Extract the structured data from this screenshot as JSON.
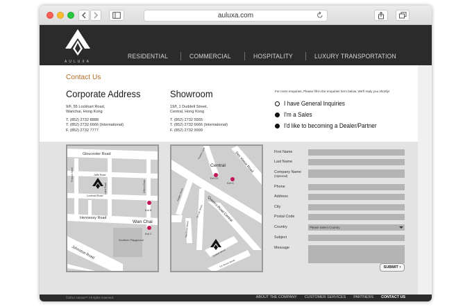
{
  "browser": {
    "url": "auluxa.com",
    "new_tab_symbol": "+"
  },
  "header": {
    "logo_text": "AULUXA",
    "nav": [
      "RESIDENTIAL",
      "COMMERCIAL",
      "HOSPITALITY",
      "LUXURY TRANSPORTATION"
    ]
  },
  "contact": {
    "title": "Contact Us",
    "corporate": {
      "heading": "Corporate Address",
      "line1": "9/F, 55 Lockhart Road,",
      "line2": "Wanchai, Hong Kong",
      "tel": "T. (852) 2732 8888",
      "tel_intl": "T. (852) 2732 6666 (International)",
      "fax": "F. (852) 2732 7777"
    },
    "showroom": {
      "heading": "Showroom",
      "line1": "19/f, 1 Duddell Street,",
      "line2": "Central, Hong Kong",
      "tel": "T. (852) 2732 5555",
      "tel_intl": "T. (852) 2732 6666 (International)",
      "fax": "F. (852) 2732 9999"
    },
    "enquiry_note": "For more enquiries, Please fill-in the enquiries form below. We'll reply you shortly!",
    "options": [
      {
        "label": "I have General Inquiries",
        "selected": false
      },
      {
        "label": "I'm a Sales",
        "selected": true
      },
      {
        "label": "I'd like to becoming a Dealer/Partner",
        "selected": true
      }
    ]
  },
  "maps": {
    "map1": {
      "gloucester": "Gloucester Road",
      "jaffe": "Jaffe Road",
      "lockhart": "Lockhart Road",
      "hennessy": "Hennessy Road",
      "johnston": "Johnston Road",
      "fenwick": "Fenwick Street",
      "luard": "Luard Road",
      "odell": "O'Brien Road",
      "wanchai": "Wan Chai",
      "exit_b": "Exit B",
      "exit_c": "Exit C",
      "playground": "Southern Playground"
    },
    "map2": {
      "central": "Central",
      "desvoeux": "Des Voeux Road",
      "queens": "Queen's Road Central",
      "theatre": "Theatre Lane",
      "pedder": "Pedder Street",
      "wyndham": "Wyndham Street",
      "onlan": "On Lan Street",
      "duddell": "Duddell Street",
      "icehouse": "Ice House Street",
      "exit_d1": "Exit D1",
      "exit_g": "Exit G"
    }
  },
  "form": {
    "first_name": "First Name",
    "last_name": "Last Name",
    "company": "Company Name",
    "company_optional": "(Optional)",
    "phone": "Phone",
    "address": "Address",
    "city": "City",
    "postal": "Postal Code",
    "country": "Country",
    "country_select": "Please Select Country",
    "subject": "Subject",
    "message": "Message",
    "submit": "SUBMIT"
  },
  "footer": {
    "copyright": "©2012 Auluxa™ All rights reserved.",
    "links": [
      "ABOUT THE COMPANY",
      "CUSTOMER SERVICES",
      "PARTNERS",
      "CONTACT US"
    ],
    "active_link": "CONTACT US"
  }
}
